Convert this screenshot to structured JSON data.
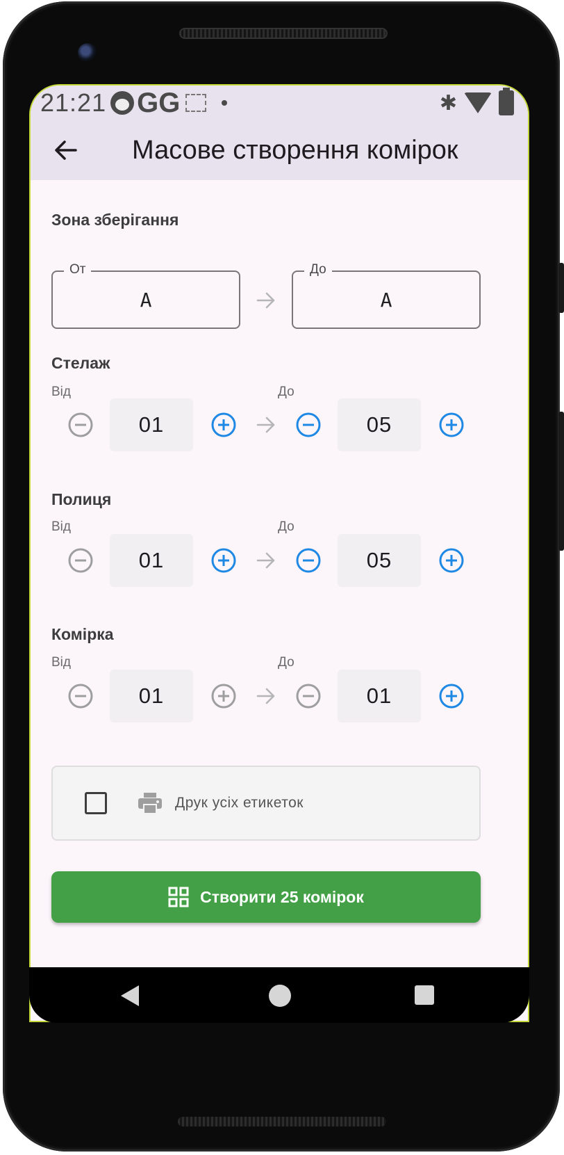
{
  "status_bar": {
    "time": "21:21",
    "g_letters": "GG"
  },
  "app_bar": {
    "title": "Масове створення комірок"
  },
  "zone": {
    "title": "Зона зберігання",
    "from_label": "От",
    "from_value": "A",
    "to_label": "До",
    "to_value": "A"
  },
  "rack": {
    "title": "Стелаж",
    "from_label": "Від",
    "to_label": "До",
    "from_value": "01",
    "to_value": "05"
  },
  "shelf": {
    "title": "Полиця",
    "from_label": "Від",
    "to_label": "До",
    "from_value": "01",
    "to_value": "05"
  },
  "cell": {
    "title": "Комірка",
    "from_label": "Від",
    "to_label": "До",
    "from_value": "01",
    "to_value": "01"
  },
  "print_option": {
    "label": "Друк усіх етикеток",
    "checked": false
  },
  "create_button": {
    "label": "Створити 25 комірок"
  },
  "colors": {
    "accent_blue": "#1e88e5",
    "disabled_grey": "#9e9e9e",
    "create_green": "#43a047",
    "app_bar_bg": "#e8e2ef",
    "screen_bg": "#fcf5fa"
  },
  "icons": {
    "back": "arrow-left-icon",
    "range_arrow": "arrow-right-icon",
    "decrement": "minus-circle-icon",
    "increment": "plus-circle-icon",
    "printer": "printer-icon",
    "create": "grid-icon"
  }
}
